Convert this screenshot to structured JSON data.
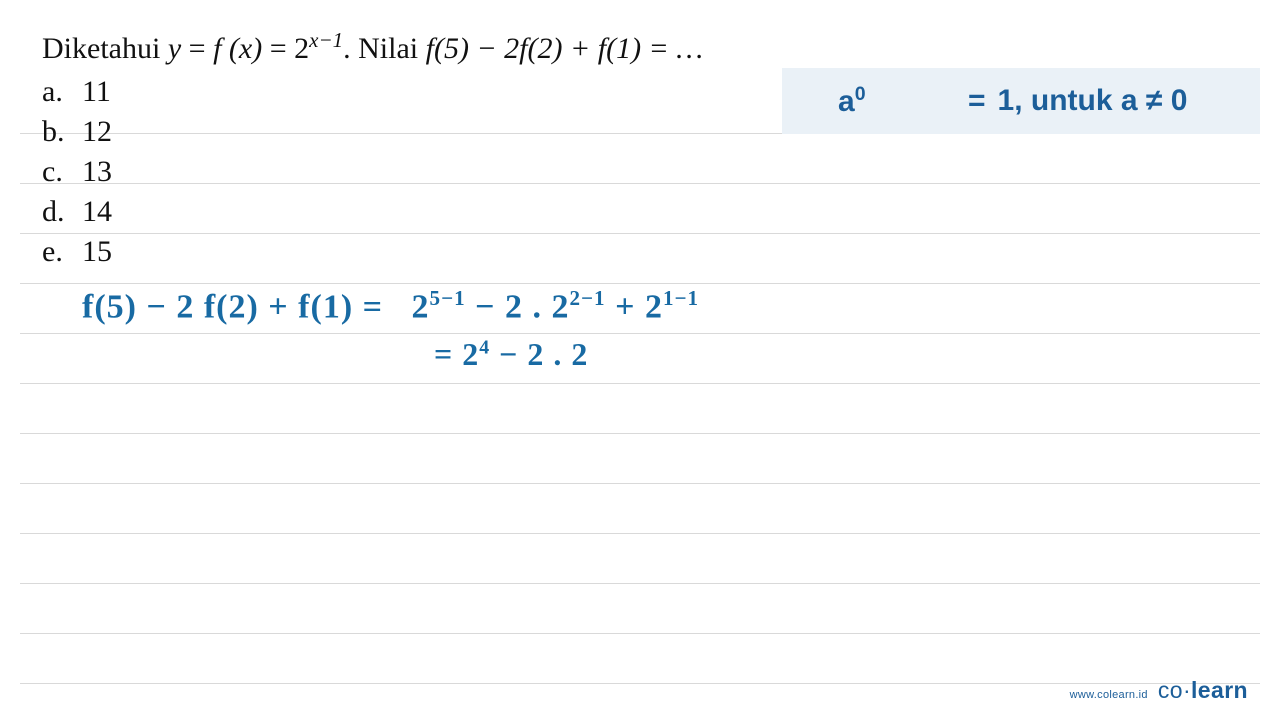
{
  "question": {
    "prefix": "Diketahui ",
    "var_y": "y",
    "eq1": " = ",
    "fx": "f (x)",
    "eq2": " = ",
    "base": "2",
    "exponent": "x−1",
    "after_formula": ". Nilai ",
    "expr": "f(5) − 2f(2) + f(1) = …"
  },
  "options": {
    "a": {
      "label": "a.",
      "val": "11"
    },
    "b": {
      "label": "b.",
      "val": "12"
    },
    "c": {
      "label": "c.",
      "val": "13"
    },
    "d": {
      "label": "d.",
      "val": "14"
    },
    "e": {
      "label": "e.",
      "val": "15"
    }
  },
  "hint": {
    "lhs_base": "a",
    "lhs_exp": "0",
    "eq": "=",
    "rhs": "1, untuk a ≠ 0"
  },
  "handwritten": {
    "line1_lhs": "f(5) − 2 f(2) + f(1) = ",
    "line1_t1_base": "2",
    "line1_t1_exp": "5−1",
    "line1_minus": " − 2 . ",
    "line1_t2_base": "2",
    "line1_t2_exp": "2−1",
    "line1_plus": " + ",
    "line1_t3_base": "2",
    "line1_t3_exp": "1−1",
    "line2_eq": "=  ",
    "line2_t1_base": "2",
    "line2_t1_exp": "4",
    "line2_rest": "  −  2 . 2"
  },
  "footer": {
    "url": "www.colearn.id",
    "brand_pre": "co·",
    "brand_bold": "learn"
  }
}
